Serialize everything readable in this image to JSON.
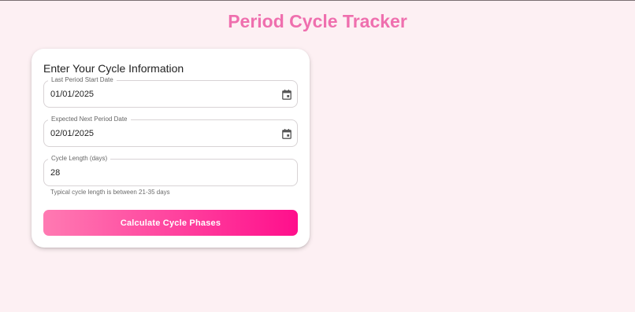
{
  "page": {
    "title": "Period Cycle Tracker"
  },
  "form": {
    "heading": "Enter Your Cycle Information",
    "last_period": {
      "label": "Last Period Start Date",
      "value": "01/01/2025",
      "icon": "calendar-icon"
    },
    "next_period": {
      "label": "Expected Next Period Date",
      "value": "02/01/2025",
      "icon": "calendar-icon"
    },
    "cycle_length": {
      "label": "Cycle Length (days)",
      "value": "28",
      "helper": "Typical cycle length is between 21-35 days"
    },
    "submit_label": "Calculate Cycle Phases"
  },
  "colors": {
    "background": "#fdf0f3",
    "title": "#ef6fae",
    "button_gradient_start": "#ff7ab2",
    "button_gradient_end": "#ff0f8c"
  }
}
